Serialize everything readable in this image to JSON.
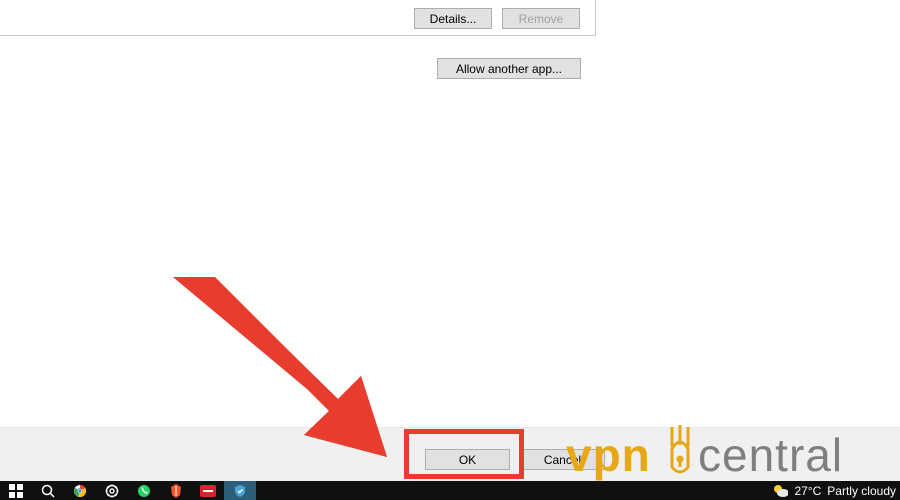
{
  "dialog": {
    "details_label": "Details...",
    "remove_label": "Remove",
    "allow_label": "Allow another app...",
    "ok_label": "OK",
    "cancel_label": "Cancel"
  },
  "annotation": {
    "highlight_color": "#e73c2e",
    "arrow_color": "#e73c2e"
  },
  "watermark": {
    "text_vpn": "vpn",
    "text_central": "central"
  },
  "taskbar": {
    "weather_temp": "27°C",
    "weather_desc": "Partly cloudy"
  }
}
